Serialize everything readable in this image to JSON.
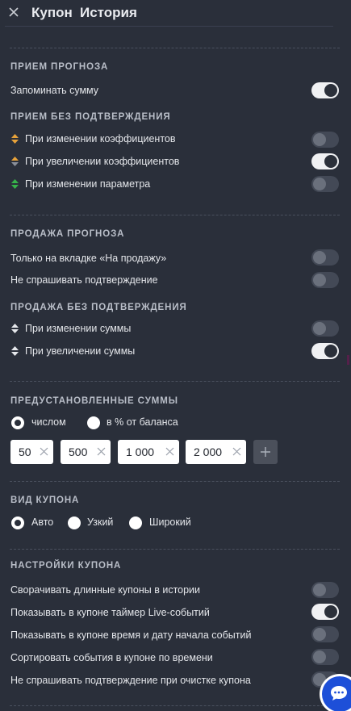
{
  "header": {
    "close_icon": "close-icon",
    "tabs": [
      "Купон",
      "История"
    ]
  },
  "colors": {
    "background": "#2a2f3a",
    "toggle_on": "#f0f1f3",
    "toggle_off": "#434956",
    "arrow_up_orange": "#e7a23a",
    "arrow_down_green": "#37b34a",
    "chat_button": "#1d4fd8"
  },
  "bet_accept": {
    "title": "ПРИЕМ ПРОГНОЗА",
    "remember_amount": {
      "label": "Запоминать сумму",
      "on": true
    },
    "no_confirm_title": "ПРИЕМ БЕЗ ПОДТВЕРЖДЕНИЯ",
    "items": [
      {
        "label": "При изменении коэффициентов",
        "icon": "updown-arrows-orange",
        "on": false
      },
      {
        "label": "При увеличении коэффициентов",
        "icon": "updown-arrows-orange-green",
        "on": true
      },
      {
        "label": "При изменении параметра",
        "icon": "updown-arrows-green",
        "on": false
      }
    ]
  },
  "bet_sale": {
    "title": "ПРОДАЖА ПРОГНОЗА",
    "items": [
      {
        "label": "Только на вкладке «На продажу»",
        "on": false
      },
      {
        "label": "Не спрашивать подтверждение",
        "on": false
      }
    ],
    "no_confirm_title": "ПРОДАЖА БЕЗ ПОДТВЕРЖДЕНИЯ",
    "no_confirm_items": [
      {
        "label": "При изменении суммы",
        "icon": "updown-arrows-white",
        "on": false
      },
      {
        "label": "При увеличении суммы",
        "icon": "updown-arrows-white",
        "on": true
      }
    ]
  },
  "preset_amounts": {
    "title": "ПРЕДУСТАНОВЛЕННЫЕ СУММЫ",
    "modes": [
      {
        "label": "числом",
        "selected": true
      },
      {
        "label": "в % от баланса",
        "selected": false
      }
    ],
    "chips": [
      "50",
      "500",
      "1 000",
      "2 000"
    ],
    "add_icon": "plus-icon"
  },
  "coupon_view": {
    "title": "ВИД КУПОНА",
    "options": [
      {
        "label": "Авто",
        "selected": true
      },
      {
        "label": "Узкий",
        "selected": false
      },
      {
        "label": "Широкий",
        "selected": false
      }
    ]
  },
  "coupon_settings": {
    "title": "НАСТРОЙКИ КУПОНА",
    "items": [
      {
        "label": "Сворачивать длинные купоны в истории",
        "on": false
      },
      {
        "label": "Показывать в купоне таймер Live-событий",
        "on": true
      },
      {
        "label": "Показывать в купоне время и дату начала событий",
        "on": false
      },
      {
        "label": "Сортировать события в купоне по времени",
        "on": false
      },
      {
        "label": "Не спрашивать подтверждение при очистке купона",
        "on": false
      }
    ]
  },
  "chat": {
    "icon": "chat-bubble-icon"
  }
}
